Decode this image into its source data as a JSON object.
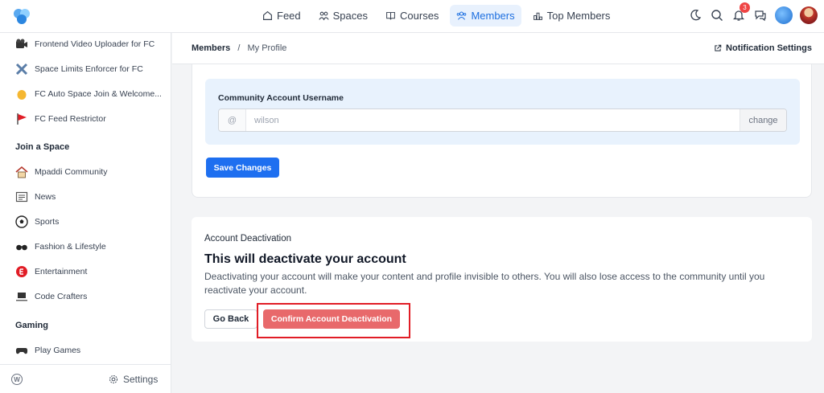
{
  "colors": {
    "accent": "#1e6ff0",
    "danger": "#e8696b",
    "highlight": "#e11d26",
    "badge": "#ef4444"
  },
  "topbar": {
    "nav": [
      {
        "label": "Feed",
        "icon": "home-icon",
        "active": false
      },
      {
        "label": "Spaces",
        "icon": "users-icon",
        "active": false
      },
      {
        "label": "Courses",
        "icon": "book-icon",
        "active": false
      },
      {
        "label": "Members",
        "icon": "members-icon",
        "active": true
      },
      {
        "label": "Top Members",
        "icon": "leaderboard-icon",
        "active": false
      }
    ],
    "notification_count": "3"
  },
  "sidebar": {
    "items": [
      {
        "label": "Frontend Video Uploader for FC",
        "icon": "camera-icon"
      },
      {
        "label": "Space Limits Enforcer for FC",
        "icon": "tools-icon"
      },
      {
        "label": "FC Auto Space Join & Welcome...",
        "icon": "wave-hand-icon"
      },
      {
        "label": "FC Feed Restrictor",
        "icon": "red-flag-icon"
      }
    ],
    "join_heading": "Join a Space",
    "spaces": [
      {
        "label": "Mpaddi Community",
        "icon": "house-icon"
      },
      {
        "label": "News",
        "icon": "newspaper-icon"
      },
      {
        "label": "Sports",
        "icon": "soccer-ball-icon"
      },
      {
        "label": "Fashion & Lifestyle",
        "icon": "sunglasses-icon"
      },
      {
        "label": "Entertainment",
        "icon": "entertainment-icon"
      },
      {
        "label": "Code Crafters",
        "icon": "laptop-icon"
      }
    ],
    "gaming_heading": "Gaming",
    "gaming": [
      {
        "label": "Play Games",
        "icon": "gamepad-icon"
      }
    ],
    "settings_label": "Settings"
  },
  "header": {
    "breadcrumb_root": "Members",
    "breadcrumb_sep": "/",
    "breadcrumb_current": "My Profile",
    "notification_settings": "Notification Settings"
  },
  "profile": {
    "username_label": "Community Account Username",
    "username_prefix": "@",
    "username_value": "wilson",
    "change_label": "change",
    "save_label": "Save Changes"
  },
  "deactivation": {
    "label": "Account Deactivation",
    "title": "This will deactivate your account",
    "description": "Deactivating your account will make your content and profile invisible to others. You will also lose access to the community until you reactivate your account.",
    "go_back": "Go Back",
    "confirm": "Confirm Account Deactivation"
  }
}
